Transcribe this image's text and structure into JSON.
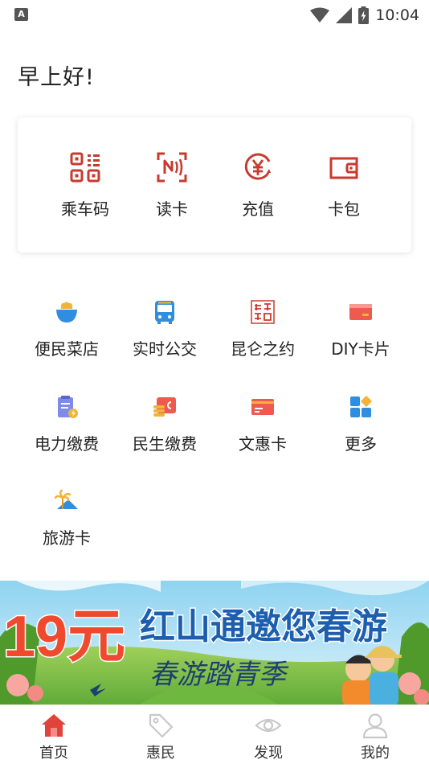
{
  "status_bar": {
    "time": "10:04",
    "notification_icon": "a-notification-icon",
    "icons": [
      "wifi-icon",
      "cell-signal-icon",
      "battery-charging-icon"
    ]
  },
  "greeting": "早上好!",
  "primary_actions": [
    {
      "label": "乘车码",
      "icon": "qr-code-icon"
    },
    {
      "label": "读卡",
      "icon": "nfc-read-icon"
    },
    {
      "label": "充值",
      "icon": "yuan-recharge-icon"
    },
    {
      "label": "卡包",
      "icon": "wallet-icon"
    }
  ],
  "services": [
    {
      "label": "便民菜店",
      "icon": "vegetable-basket-icon"
    },
    {
      "label": "实时公交",
      "icon": "bus-icon"
    },
    {
      "label": "昆仑之约",
      "icon": "kunlun-seal-icon"
    },
    {
      "label": "DIY卡片",
      "icon": "card-icon"
    },
    {
      "label": "电力缴费",
      "icon": "electric-bill-icon"
    },
    {
      "label": "民生缴费",
      "icon": "wallet-payment-icon"
    },
    {
      "label": "文惠卡",
      "icon": "culture-card-icon"
    },
    {
      "label": "更多",
      "icon": "more-grid-icon"
    },
    {
      "label": "旅游卡",
      "icon": "travel-palm-icon"
    }
  ],
  "banner": {
    "big_price": "19元",
    "headline": "红山通邀您春游",
    "sub": "春游踏青季"
  },
  "tabs": [
    {
      "label": "首页",
      "icon": "home-icon",
      "active": true
    },
    {
      "label": "惠民",
      "icon": "tag-icon",
      "active": false
    },
    {
      "label": "发现",
      "icon": "eye-icon",
      "active": false
    },
    {
      "label": "我的",
      "icon": "person-icon",
      "active": false
    }
  ],
  "colors": {
    "brand_red": "#e0433a",
    "icon_red": "#c83a2e",
    "tab_inactive": "#c8c8c8"
  }
}
